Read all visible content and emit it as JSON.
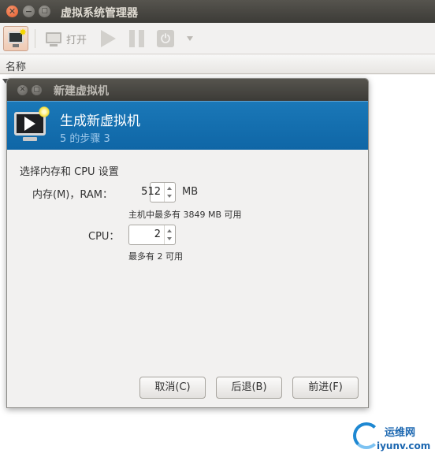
{
  "window": {
    "title": "虚拟系统管理器",
    "close_glyph": "✕",
    "min_glyph": "−",
    "max_glyph": "▢"
  },
  "toolbar": {
    "open_label": "打开",
    "power_glyph": "⏻"
  },
  "list": {
    "column_name": "名称"
  },
  "dialog": {
    "title": "新建虚拟机",
    "close_glyph": "✕",
    "max_glyph": "▢",
    "banner_title": "生成新虚拟机",
    "banner_step": "5 的步骤 3",
    "section_label": "选择内存和 CPU 设置",
    "ram_label": "内存(M)，RAM：",
    "ram_value": "512",
    "ram_unit": "MB",
    "ram_hint": "主机中最多有 3849 MB 可用",
    "cpu_label": "CPU：",
    "cpu_value": "2",
    "cpu_hint": "最多有 2 可用",
    "cancel_label": "取消(C)",
    "back_label": "后退(B)",
    "forward_label": "前进(F)"
  },
  "watermark": {
    "line1": "运维网",
    "line2": "iyunv.com"
  },
  "colors": {
    "banner": "#1a78b8",
    "titlebar": "#3c3b37"
  }
}
